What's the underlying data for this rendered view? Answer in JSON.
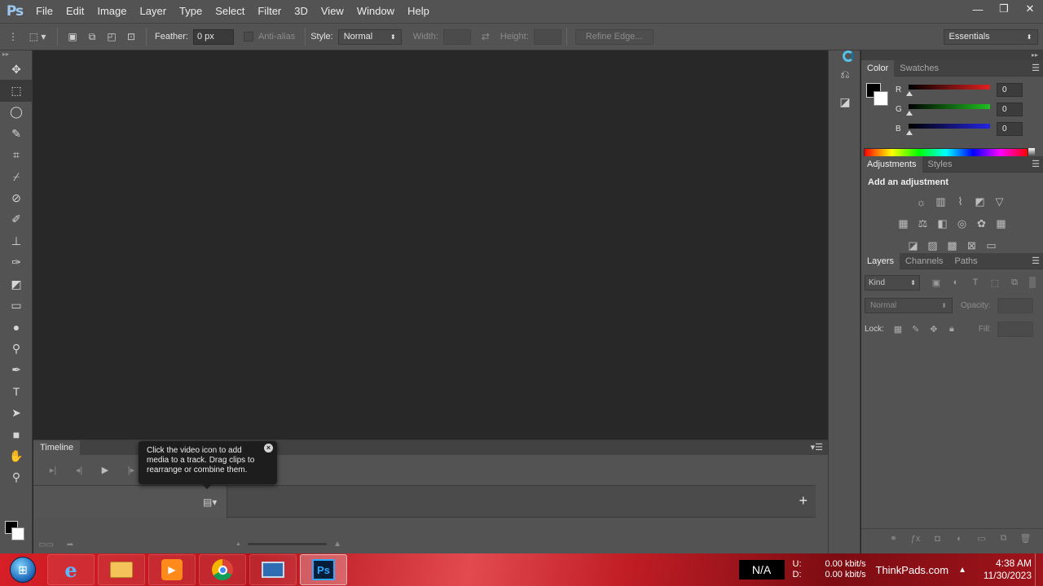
{
  "app": {
    "logo": "Ps"
  },
  "menu": [
    "File",
    "Edit",
    "Image",
    "Layer",
    "Type",
    "Select",
    "Filter",
    "3D",
    "View",
    "Window",
    "Help"
  ],
  "window_controls": {
    "minimize": "—",
    "restore": "❐",
    "close": "✕"
  },
  "options_bar": {
    "feather_label": "Feather:",
    "feather_value": "0 px",
    "antialias_label": "Anti-alias",
    "style_label": "Style:",
    "style_value": "Normal",
    "width_label": "Width:",
    "height_label": "Height:",
    "refine_edge": "Refine Edge...",
    "workspace": "Essentials"
  },
  "timeline": {
    "tab": "Timeline",
    "tooltip": "Click the video icon to add media to a track. Drag clips to rearrange or combine them.",
    "add": "+"
  },
  "color_panel": {
    "tabs": [
      "Color",
      "Swatches"
    ],
    "channels": [
      {
        "label": "R",
        "value": "0",
        "color": "#e02020"
      },
      {
        "label": "G",
        "value": "0",
        "color": "#1fbf1f"
      },
      {
        "label": "B",
        "value": "0",
        "color": "#2424e0"
      }
    ]
  },
  "adjustments_panel": {
    "tabs": [
      "Adjustments",
      "Styles"
    ],
    "title": "Add an adjustment"
  },
  "layers_panel": {
    "tabs": [
      "Layers",
      "Channels",
      "Paths"
    ],
    "kind": "Kind",
    "blend_mode": "Normal",
    "opacity_label": "Opacity:",
    "lock_label": "Lock:",
    "fill_label": "Fill:"
  },
  "taskbar": {
    "na": "N/A",
    "upload_label": "U:",
    "download_label": "D:",
    "upload": "0.00 kbit/s",
    "download": "0.00 kbit/s",
    "brand": "ThinkPads.com",
    "time": "4:38 AM",
    "date": "11/30/2023"
  }
}
